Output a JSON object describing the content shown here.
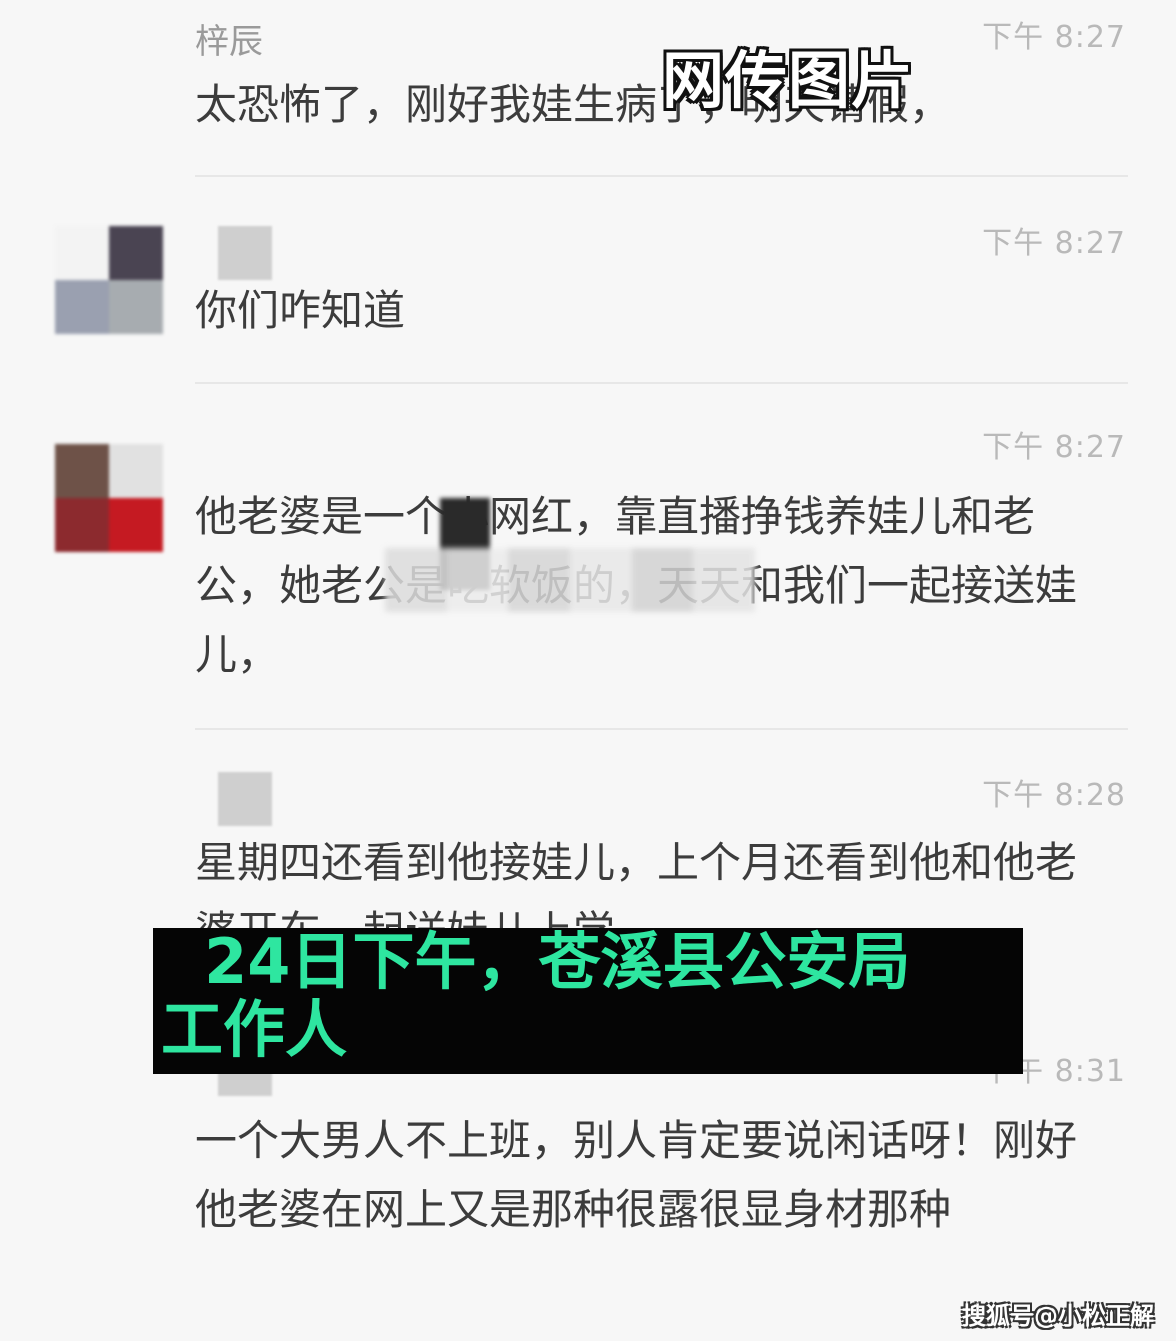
{
  "overlay_tag": "网传图片",
  "caption": "  24日下午，苍溪县公安局\n工作人",
  "watermark": "搜狐号@小松正解",
  "messages": [
    {
      "sender": "梓辰",
      "time": "下午 8:27",
      "text": "太恐怖了，刚好我娃生病了，明天请假，"
    },
    {
      "sender": "",
      "time": "下午 8:27",
      "text": "你们咋知道"
    },
    {
      "sender": "",
      "time": "下午 8:27",
      "text": "他老婆是一个小网红，靠直播挣钱养娃儿和老公，她老公是吃软饭的，天天和我们一起接送娃儿，"
    },
    {
      "sender": "",
      "time": "下午 8:28",
      "text": "星期四还看到他接娃儿，上个月还看到他和他老婆开车一起送娃儿上学"
    },
    {
      "sender": "",
      "time": "下午 8:31",
      "text": "一个大男人不上班，别人肯定要说闲话呀！刚好他老婆在网上又是那种很露很显身材那种"
    }
  ],
  "colors": {
    "background": "#f7f7f7",
    "message_text": "#3c3c3c",
    "time_text": "#b9b9b9",
    "caption_text": "#2ee6a0",
    "caption_bg": "#050505"
  }
}
